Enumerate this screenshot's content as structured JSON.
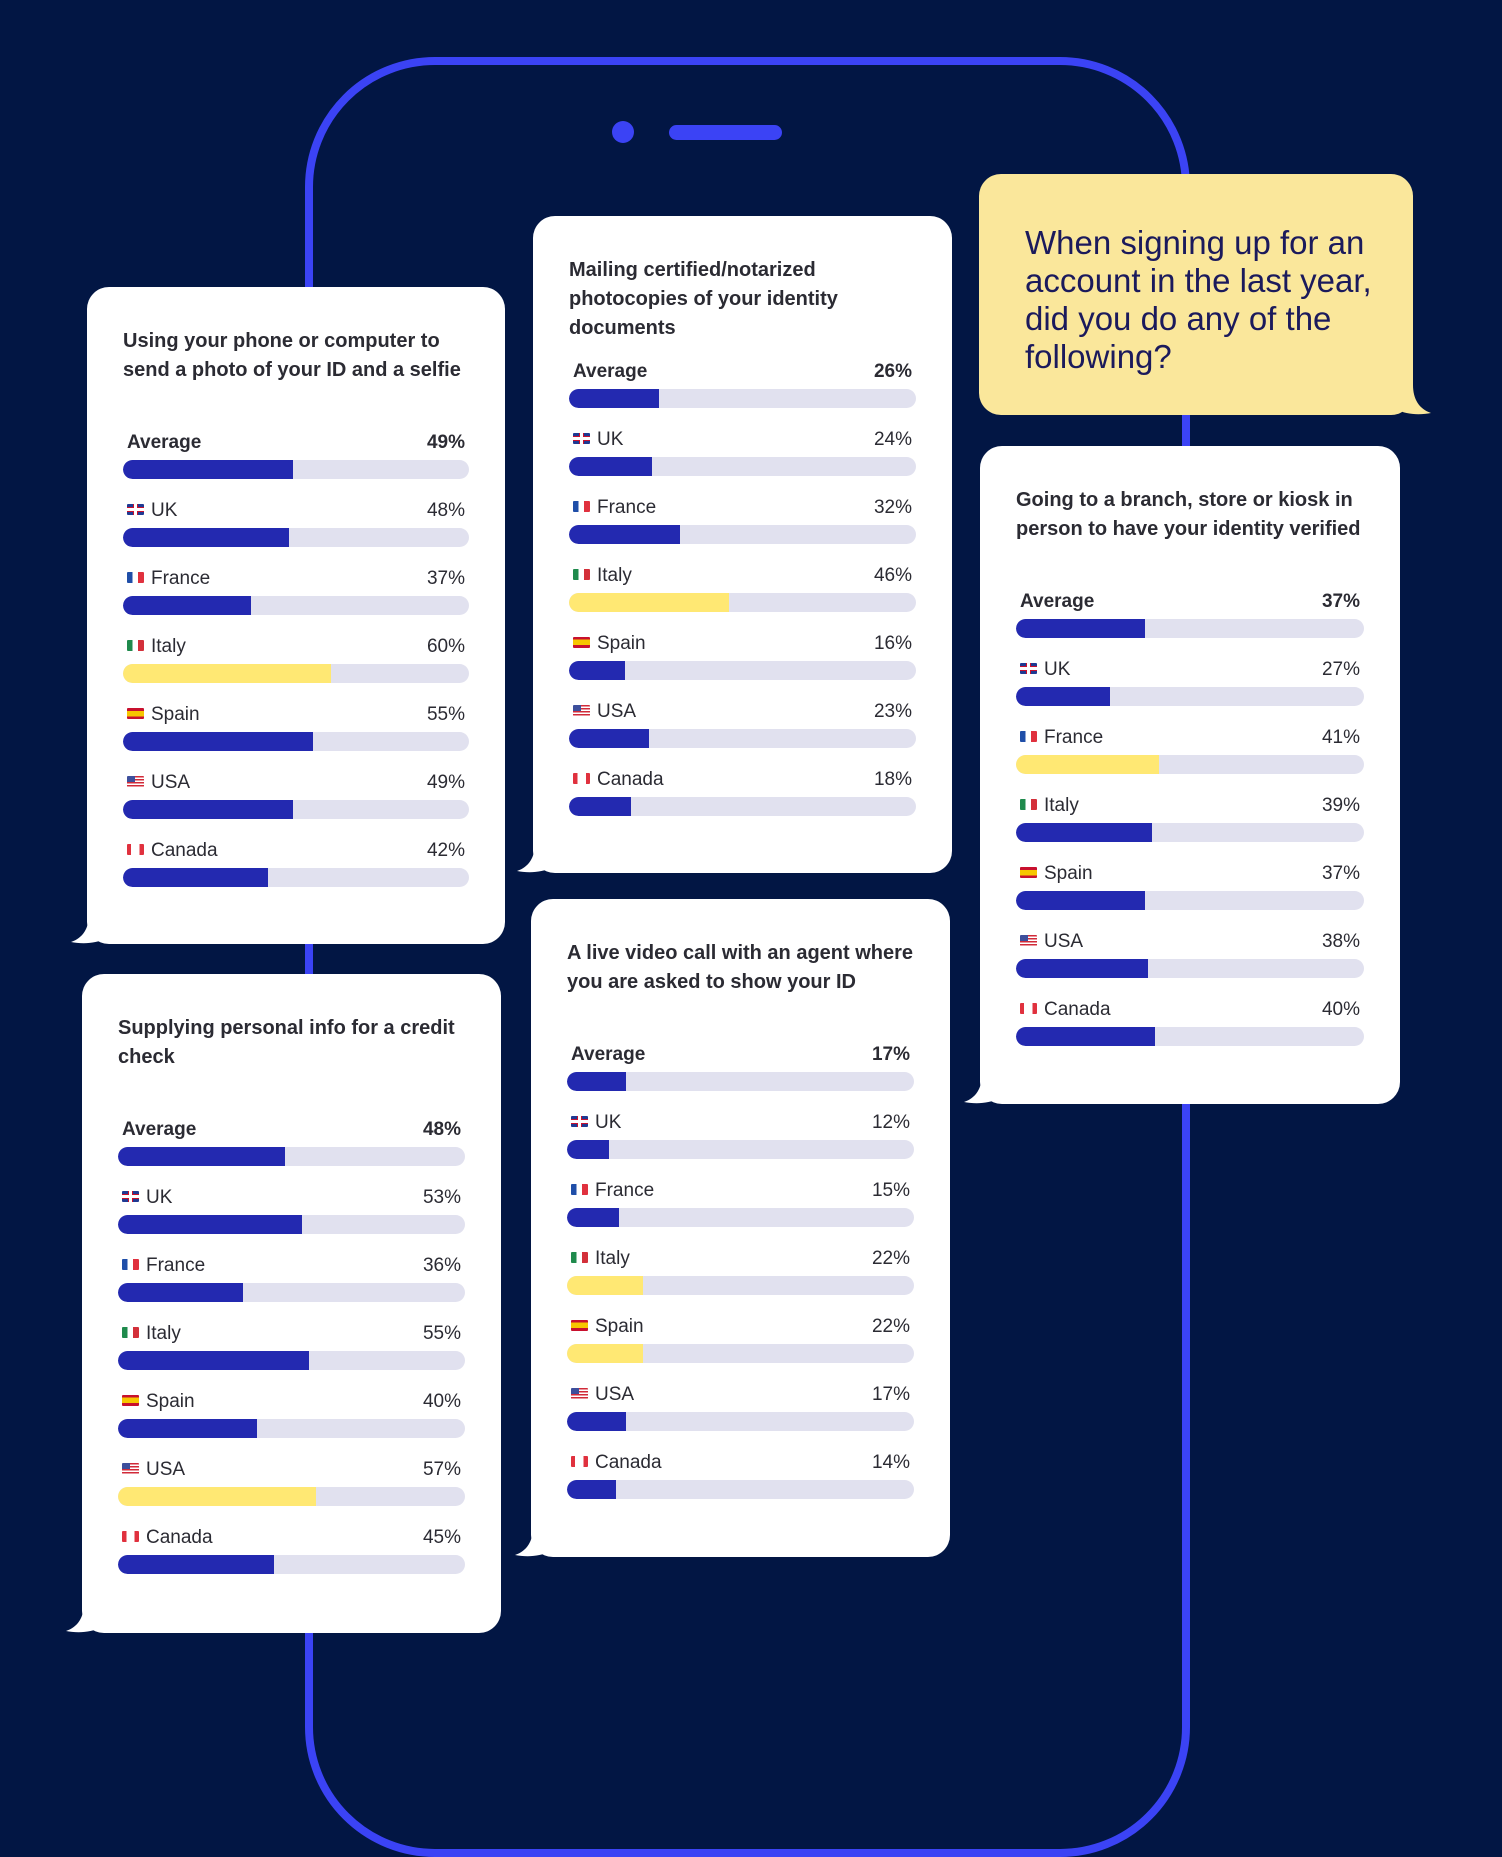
{
  "question": "When signing up for an account in the last year, did you do any of the following?",
  "colors": {
    "background": "#021644",
    "phone_outline": "#3b43f5",
    "bar_default": "#2329b0",
    "bar_highlight": "#ffe873",
    "track": "#e1e1ef",
    "question_bubble": "#fae79b"
  },
  "chart_data": [
    {
      "type": "bar",
      "orientation": "horizontal",
      "title": "Using your phone or computer to send a photo of your ID and a selfie",
      "categories": [
        "Average",
        "UK",
        "France",
        "Italy",
        "Spain",
        "USA",
        "Canada"
      ],
      "values": [
        49,
        48,
        37,
        60,
        55,
        49,
        42
      ],
      "labels": [
        "49%",
        "48%",
        "37%",
        "60%",
        "55%",
        "49%",
        "42%"
      ],
      "highlight": "Italy",
      "xlim": [
        0,
        100
      ]
    },
    {
      "type": "bar",
      "orientation": "horizontal",
      "title": "Mailing certified/notarized photocopies of your identity documents",
      "categories": [
        "Average",
        "UK",
        "France",
        "Italy",
        "Spain",
        "USA",
        "Canada"
      ],
      "values": [
        26,
        24,
        32,
        46,
        16,
        23,
        18
      ],
      "labels": [
        "26%",
        "24%",
        "32%",
        "46%",
        "16%",
        "23%",
        "18%"
      ],
      "highlight": "Italy",
      "xlim": [
        0,
        100
      ]
    },
    {
      "type": "bar",
      "orientation": "horizontal",
      "title": "Supplying personal info for a credit check",
      "categories": [
        "Average",
        "UK",
        "France",
        "Italy",
        "Spain",
        "USA",
        "Canada"
      ],
      "values": [
        48,
        53,
        36,
        55,
        40,
        57,
        45
      ],
      "labels": [
        "48%",
        "53%",
        "36%",
        "55%",
        "40%",
        "57%",
        "45%"
      ],
      "highlight": "USA",
      "xlim": [
        0,
        100
      ]
    },
    {
      "type": "bar",
      "orientation": "horizontal",
      "title": "A live video call with an agent where you are asked to show your ID",
      "categories": [
        "Average",
        "UK",
        "France",
        "Italy",
        "Spain",
        "USA",
        "Canada"
      ],
      "values": [
        17,
        12,
        15,
        22,
        22,
        17,
        14
      ],
      "labels": [
        "17%",
        "12%",
        "15%",
        "22%",
        "22%",
        "17%",
        "14%"
      ],
      "highlight": [
        "Italy",
        "Spain"
      ],
      "xlim": [
        0,
        100
      ]
    },
    {
      "type": "bar",
      "orientation": "horizontal",
      "title": "Going to a branch, store or kiosk in person to have your identity verified",
      "categories": [
        "Average",
        "UK",
        "France",
        "Italy",
        "Spain",
        "USA",
        "Canada"
      ],
      "values": [
        37,
        27,
        41,
        39,
        37,
        38,
        40
      ],
      "labels": [
        "37%",
        "27%",
        "41%",
        "39%",
        "37%",
        "38%",
        "40%"
      ],
      "highlight": "France",
      "xlim": [
        0,
        100
      ]
    }
  ],
  "flag_icons": {
    "UK": "uk-flag-icon",
    "France": "france-flag-icon",
    "Italy": "italy-flag-icon",
    "Spain": "spain-flag-icon",
    "USA": "usa-flag-icon",
    "Canada": "canada-flag-icon"
  }
}
